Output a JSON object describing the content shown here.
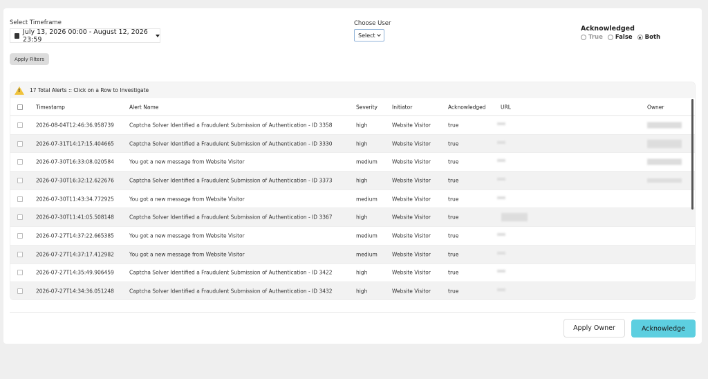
{
  "filters": {
    "timeframe_label": "Select Timeframe",
    "timeframe_value": "July 13, 2026 00:00 - August 12, 2026 23:59",
    "user_label": "Choose User",
    "user_select": "Select",
    "acknowledged_label": "Acknowledged",
    "ack_options": [
      "True",
      "False",
      "Both"
    ],
    "ack_selected": "Both",
    "apply_button": "Apply Filters"
  },
  "alert_summary": "17 Total Alerts :: Click on a Row to Investigate",
  "table": {
    "headers": {
      "timestamp": "Timestamp",
      "alert_name": "Alert Name",
      "severity": "Severity",
      "initiator": "Initiator",
      "acknowledged": "Acknowledged",
      "url": "URL",
      "owner": "Owner"
    },
    "rows": [
      {
        "timestamp": "2026-08-04T12:46:36.958739",
        "alert_name": "Captcha Solver Identified a Fraudulent Submission of Authentication - ID 3358",
        "severity": "high",
        "initiator": "Website Visitor",
        "acknowledged": "true"
      },
      {
        "timestamp": "2026-07-31T14:17:15.404665",
        "alert_name": "Captcha Solver Identified a Fraudulent Submission of Authentication - ID 3330",
        "severity": "high",
        "initiator": "Website Visitor",
        "acknowledged": "true"
      },
      {
        "timestamp": "2026-07-30T16:33:08.020584",
        "alert_name": "You got a new message from Website Visitor",
        "severity": "medium",
        "initiator": "Website Visitor",
        "acknowledged": "true"
      },
      {
        "timestamp": "2026-07-30T16:32:12.622676",
        "alert_name": "Captcha Solver Identified a Fraudulent Submission of Authentication - ID 3373",
        "severity": "high",
        "initiator": "Website Visitor",
        "acknowledged": "true"
      },
      {
        "timestamp": "2026-07-30T11:43:34.772925",
        "alert_name": "You got a new message from Website Visitor",
        "severity": "medium",
        "initiator": "Website Visitor",
        "acknowledged": "true"
      },
      {
        "timestamp": "2026-07-30T11:41:05.508148",
        "alert_name": "Captcha Solver Identified a Fraudulent Submission of Authentication - ID 3367",
        "severity": "high",
        "initiator": "Website Visitor",
        "acknowledged": "true"
      },
      {
        "timestamp": "2026-07-27T14:37:22.665385",
        "alert_name": "You got a new message from Website Visitor",
        "severity": "medium",
        "initiator": "Website Visitor",
        "acknowledged": "true"
      },
      {
        "timestamp": "2026-07-27T14:37:17.412982",
        "alert_name": "You got a new message from Website Visitor",
        "severity": "medium",
        "initiator": "Website Visitor",
        "acknowledged": "true"
      },
      {
        "timestamp": "2026-07-27T14:35:49.906459",
        "alert_name": "Captcha Solver Identified a Fraudulent Submission of Authentication - ID 3422",
        "severity": "high",
        "initiator": "Website Visitor",
        "acknowledged": "true"
      },
      {
        "timestamp": "2026-07-27T14:34:36.051248",
        "alert_name": "Captcha Solver Identified a Fraudulent Submission of Authentication - ID 3432",
        "severity": "high",
        "initiator": "Website Visitor",
        "acknowledged": "true"
      }
    ]
  },
  "actions": {
    "apply_owner": "Apply Owner",
    "acknowledge": "Acknowledge"
  },
  "colors": {
    "acknowledge_button": "#5dcfe0",
    "warning_icon": "#f0c23a",
    "page_background": "#efefef"
  }
}
